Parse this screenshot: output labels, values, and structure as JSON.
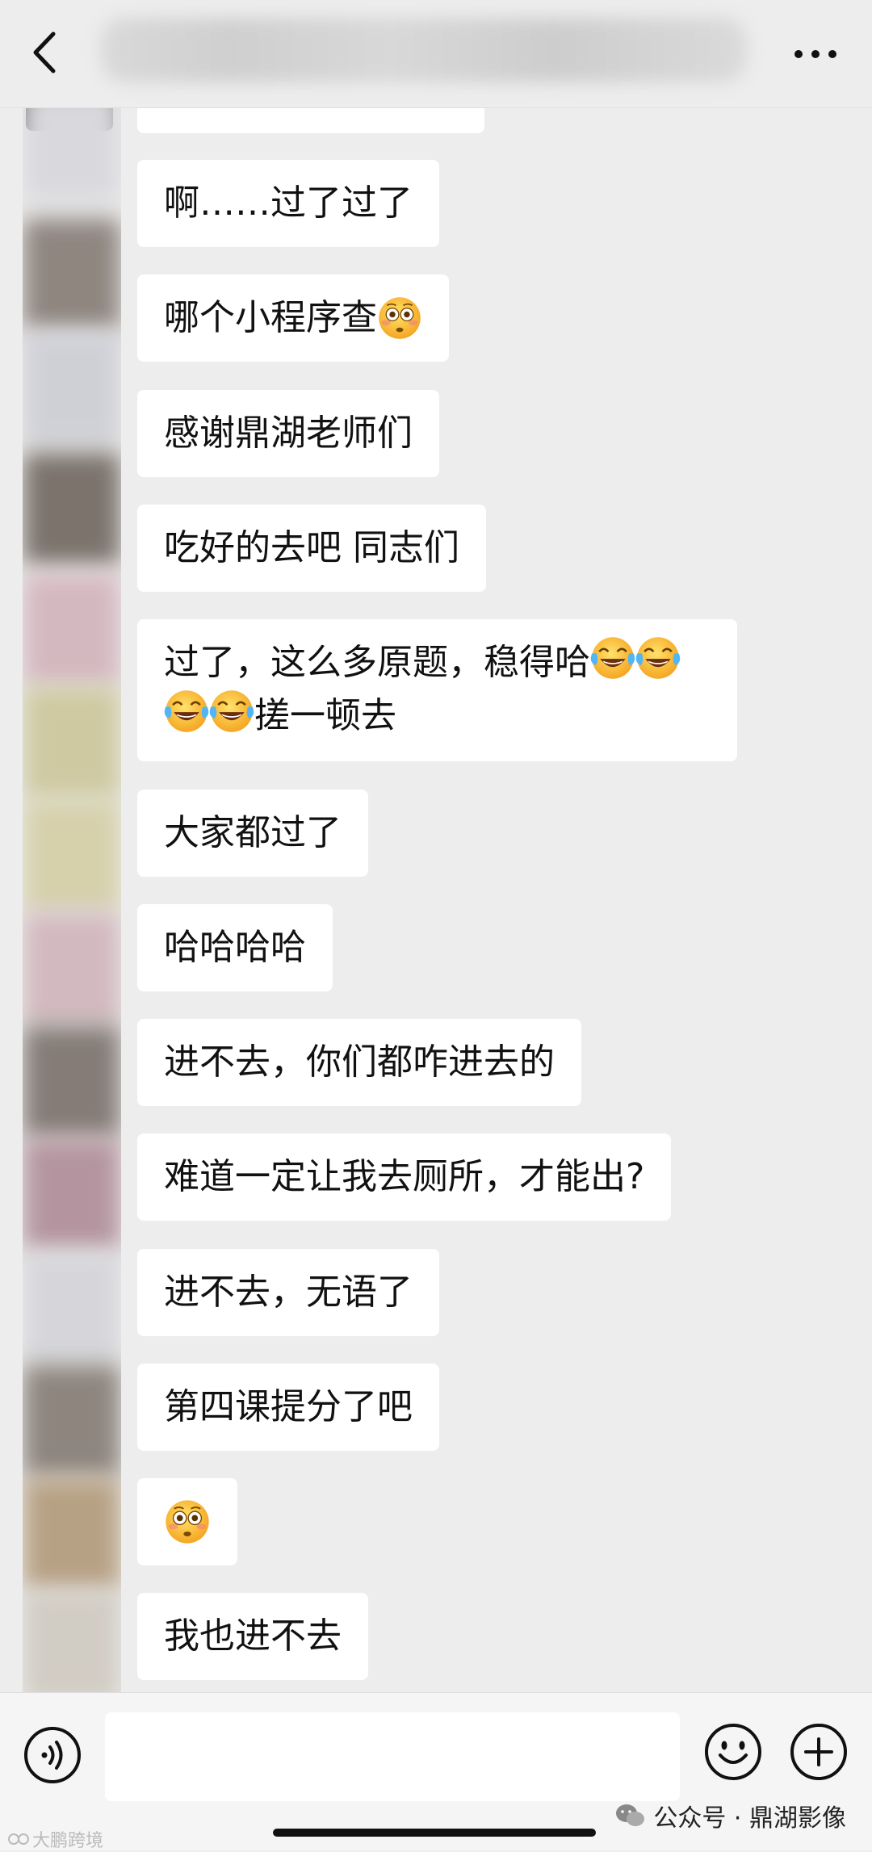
{
  "header": {
    "title": "",
    "back_icon": "chevron-left-icon",
    "more_icon": "ellipsis-icon"
  },
  "messages": [
    {
      "text": "啊……过了过了"
    },
    {
      "text": "哪个小程序查",
      "emoji": "flushed-face"
    },
    {
      "text": "感谢鼎湖老师们"
    },
    {
      "text": "吃好的去吧 同志们"
    },
    {
      "line1": "过了，这么多原题，稳得哈",
      "line2": "搓一顿去",
      "emoji": "tears-of-joy"
    },
    {
      "text": "大家都过了"
    },
    {
      "text": "哈哈哈哈"
    },
    {
      "text": "进不去，你们都咋进去的"
    },
    {
      "text": "难道一定让我去厕所，才能出?"
    },
    {
      "text": "进不去，无语了"
    },
    {
      "text": "第四课提分了吧"
    },
    {
      "text": "",
      "emoji": "flushed-face"
    },
    {
      "text": "我也进不去"
    }
  ],
  "input_bar": {
    "placeholder": "",
    "voice_icon": "voice-icon",
    "emoji_icon": "smiley-icon",
    "plus_icon": "plus-icon"
  },
  "watermark": {
    "text": "公众号 · 鼎湖影像",
    "left_text": "大鹏跨境"
  },
  "colors": {
    "background": "#ededed",
    "bubble": "#ffffff",
    "text": "#111111"
  }
}
